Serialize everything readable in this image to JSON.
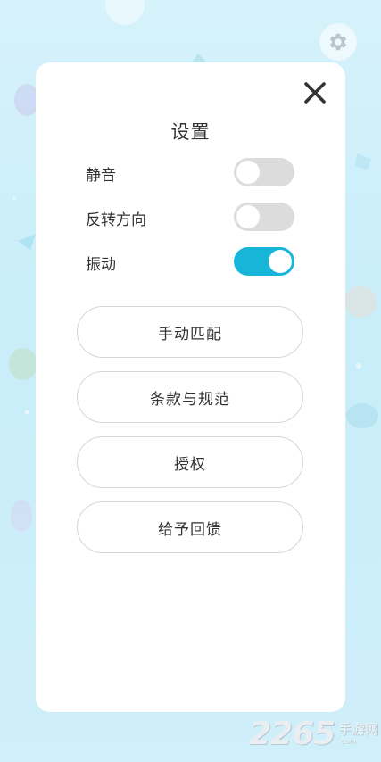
{
  "settings": {
    "title": "设置",
    "toggles": [
      {
        "label": "静音",
        "on": false
      },
      {
        "label": "反转方向",
        "on": false
      },
      {
        "label": "振动",
        "on": true
      }
    ],
    "buttons": {
      "manual_match": "手动匹配",
      "terms": "条款与规范",
      "authorize": "授权",
      "feedback": "给予回馈"
    }
  },
  "icons": {
    "gear": "gear-icon",
    "close": "close-icon"
  },
  "colors": {
    "toggle_on": "#17b6d9",
    "toggle_off": "#dcdcdc",
    "background": "#d6f2fb"
  },
  "watermark": {
    "number": "2265",
    "text_cn": "手游网",
    "text_en": ".com"
  }
}
